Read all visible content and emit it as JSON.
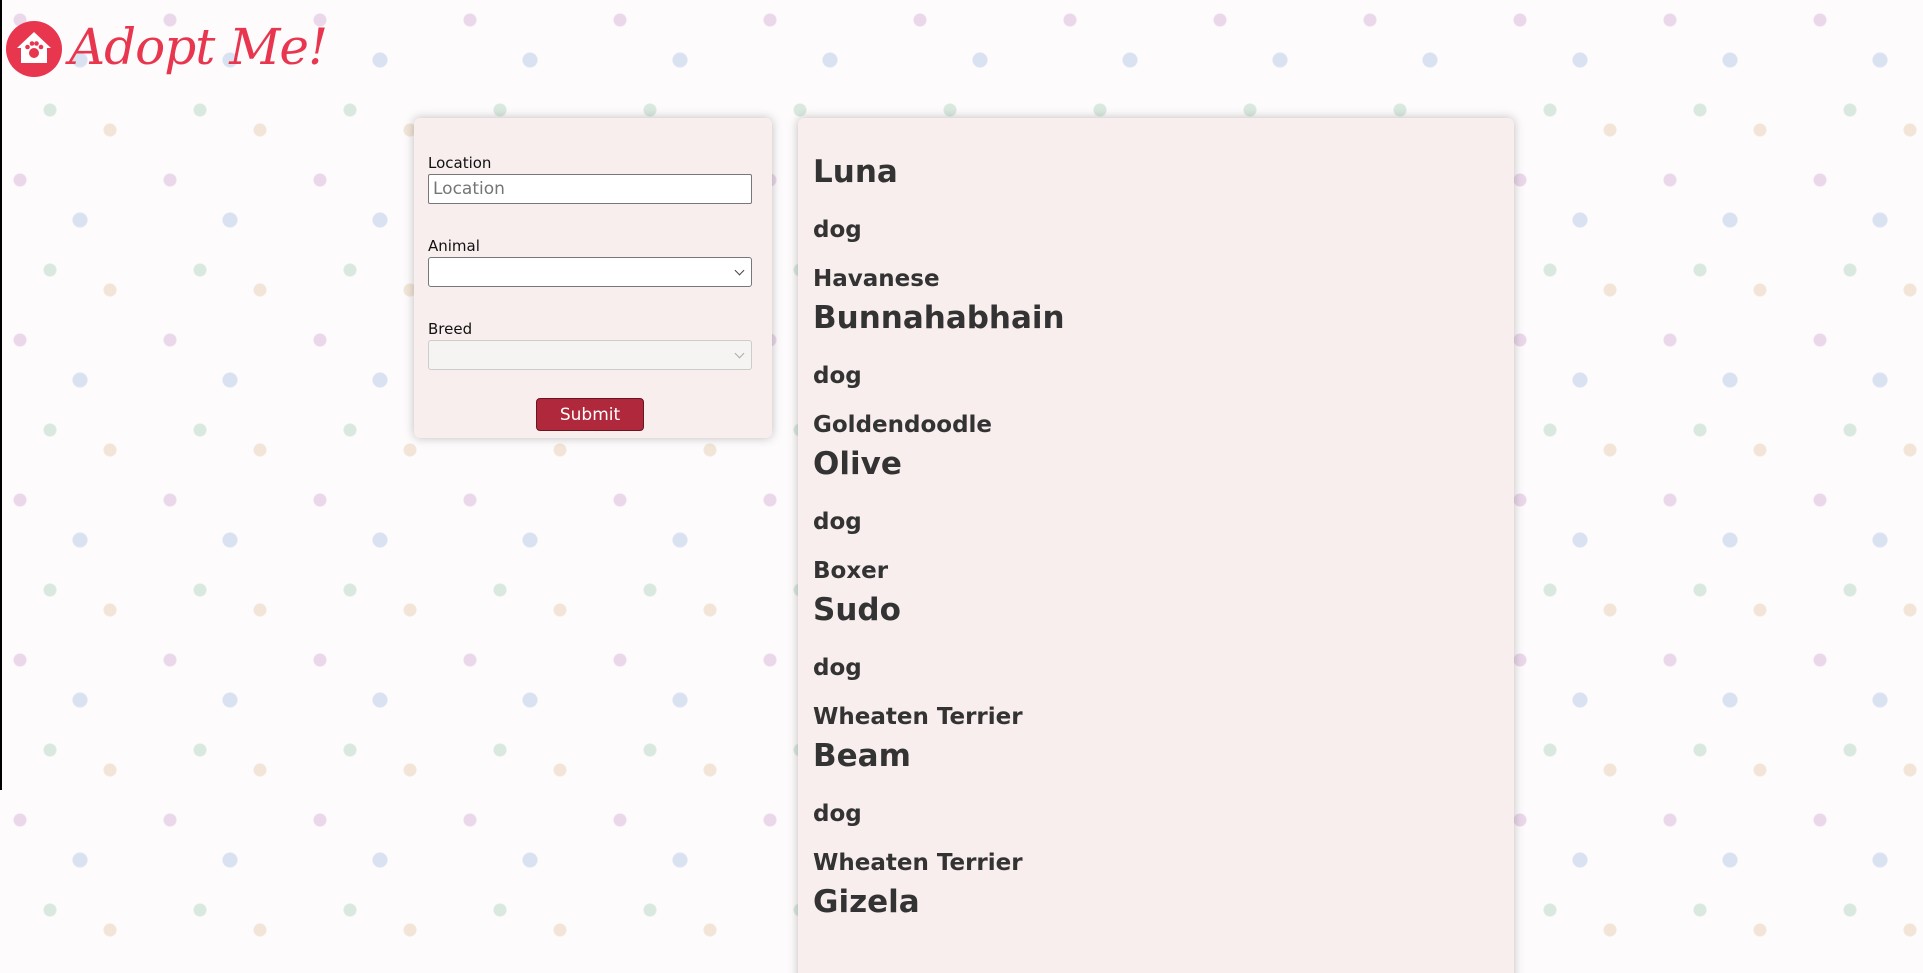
{
  "brand": {
    "logo_text": "Adopt Me!",
    "accent_color": "#e8364f"
  },
  "search_form": {
    "location": {
      "label": "Location",
      "placeholder": "Location",
      "value": ""
    },
    "animal": {
      "label": "Animal",
      "selected": ""
    },
    "breed": {
      "label": "Breed",
      "selected": "",
      "disabled": true
    },
    "submit_label": "Submit",
    "submit_color": "#b0283c"
  },
  "results": {
    "pets": [
      {
        "name": "Luna",
        "animal": "dog",
        "breed": "Havanese"
      },
      {
        "name": "Bunnahabhain",
        "animal": "dog",
        "breed": "Goldendoodle"
      },
      {
        "name": "Olive",
        "animal": "dog",
        "breed": "Boxer"
      },
      {
        "name": "Sudo",
        "animal": "dog",
        "breed": "Wheaten Terrier"
      },
      {
        "name": "Beam",
        "animal": "dog",
        "breed": "Wheaten Terrier"
      },
      {
        "name": "Gizela",
        "animal": "",
        "breed": ""
      }
    ]
  }
}
